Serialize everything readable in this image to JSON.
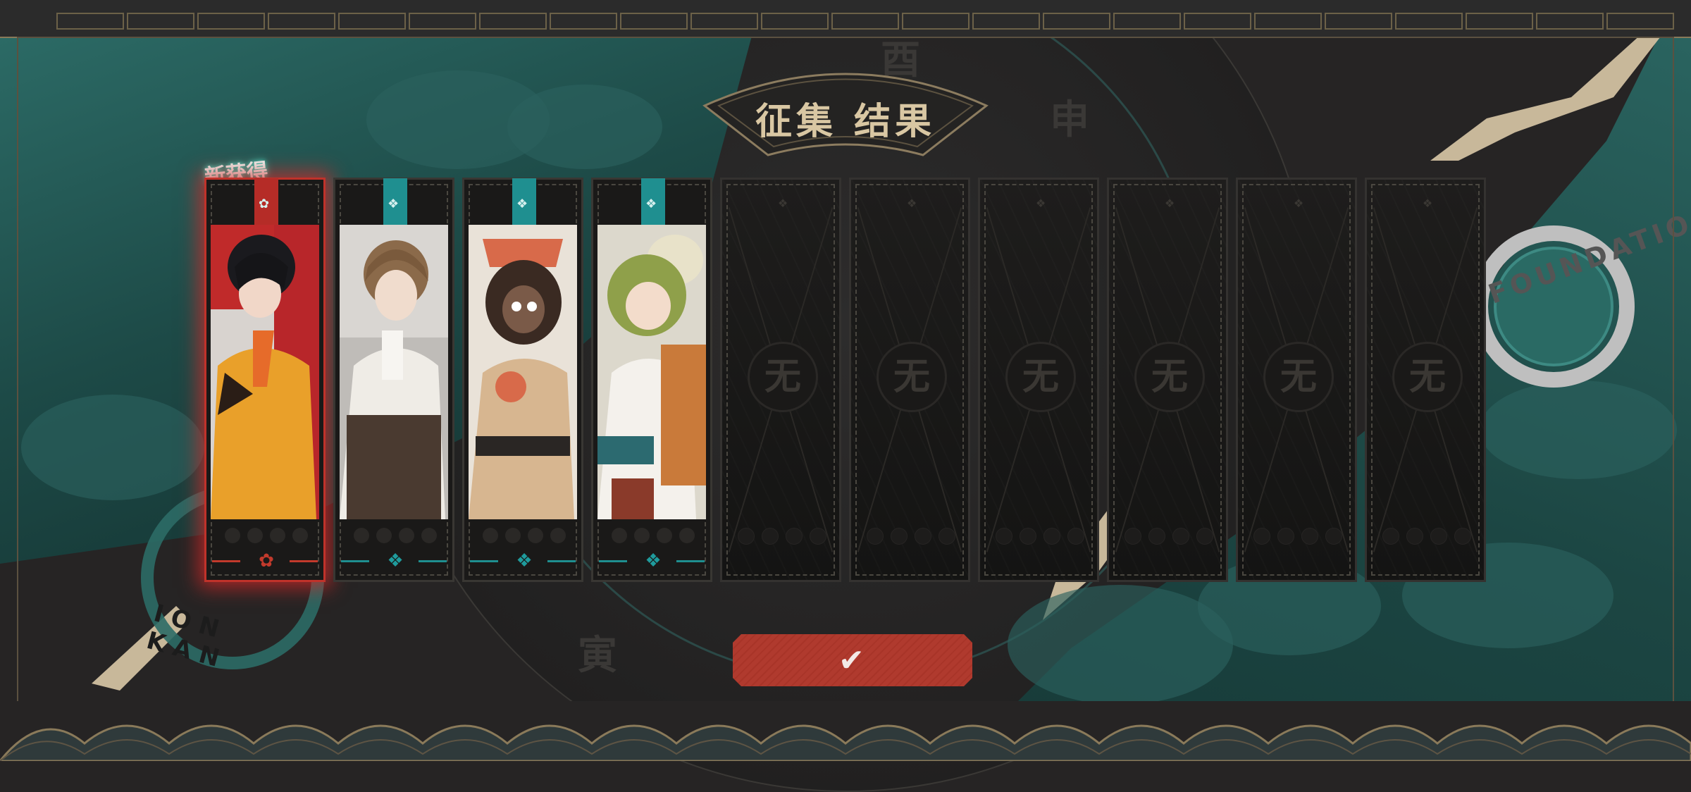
{
  "screen": {
    "title": "征集 结果",
    "new_label": "新获得",
    "confirm_icon": "✔",
    "empty_glyph": "无",
    "accent_red": "#c0322a",
    "accent_teal": "#1f8f90"
  },
  "seals": {
    "left_text": "ION KAN",
    "right_text": "FOUNDATIO"
  },
  "cards": [
    {
      "state": "new",
      "rarity": "red"
    },
    {
      "state": "filled",
      "rarity": "teal"
    },
    {
      "state": "filled",
      "rarity": "teal"
    },
    {
      "state": "filled",
      "rarity": "teal"
    },
    {
      "state": "empty"
    },
    {
      "state": "empty"
    },
    {
      "state": "empty"
    },
    {
      "state": "empty"
    },
    {
      "state": "empty"
    },
    {
      "state": "empty"
    }
  ]
}
